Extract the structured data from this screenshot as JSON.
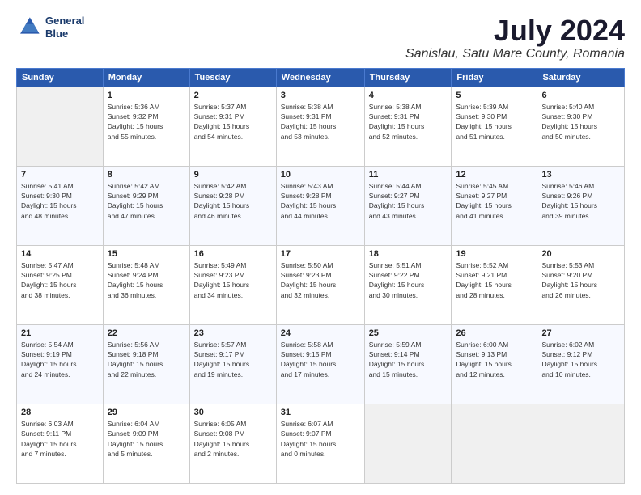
{
  "logo": {
    "line1": "General",
    "line2": "Blue"
  },
  "title": "July 2024",
  "subtitle": "Sanislau, Satu Mare County, Romania",
  "days_of_week": [
    "Sunday",
    "Monday",
    "Tuesday",
    "Wednesday",
    "Thursday",
    "Friday",
    "Saturday"
  ],
  "weeks": [
    [
      {
        "day": "",
        "info": ""
      },
      {
        "day": "1",
        "info": "Sunrise: 5:36 AM\nSunset: 9:32 PM\nDaylight: 15 hours\nand 55 minutes."
      },
      {
        "day": "2",
        "info": "Sunrise: 5:37 AM\nSunset: 9:31 PM\nDaylight: 15 hours\nand 54 minutes."
      },
      {
        "day": "3",
        "info": "Sunrise: 5:38 AM\nSunset: 9:31 PM\nDaylight: 15 hours\nand 53 minutes."
      },
      {
        "day": "4",
        "info": "Sunrise: 5:38 AM\nSunset: 9:31 PM\nDaylight: 15 hours\nand 52 minutes."
      },
      {
        "day": "5",
        "info": "Sunrise: 5:39 AM\nSunset: 9:30 PM\nDaylight: 15 hours\nand 51 minutes."
      },
      {
        "day": "6",
        "info": "Sunrise: 5:40 AM\nSunset: 9:30 PM\nDaylight: 15 hours\nand 50 minutes."
      }
    ],
    [
      {
        "day": "7",
        "info": "Sunrise: 5:41 AM\nSunset: 9:30 PM\nDaylight: 15 hours\nand 48 minutes."
      },
      {
        "day": "8",
        "info": "Sunrise: 5:42 AM\nSunset: 9:29 PM\nDaylight: 15 hours\nand 47 minutes."
      },
      {
        "day": "9",
        "info": "Sunrise: 5:42 AM\nSunset: 9:28 PM\nDaylight: 15 hours\nand 46 minutes."
      },
      {
        "day": "10",
        "info": "Sunrise: 5:43 AM\nSunset: 9:28 PM\nDaylight: 15 hours\nand 44 minutes."
      },
      {
        "day": "11",
        "info": "Sunrise: 5:44 AM\nSunset: 9:27 PM\nDaylight: 15 hours\nand 43 minutes."
      },
      {
        "day": "12",
        "info": "Sunrise: 5:45 AM\nSunset: 9:27 PM\nDaylight: 15 hours\nand 41 minutes."
      },
      {
        "day": "13",
        "info": "Sunrise: 5:46 AM\nSunset: 9:26 PM\nDaylight: 15 hours\nand 39 minutes."
      }
    ],
    [
      {
        "day": "14",
        "info": "Sunrise: 5:47 AM\nSunset: 9:25 PM\nDaylight: 15 hours\nand 38 minutes."
      },
      {
        "day": "15",
        "info": "Sunrise: 5:48 AM\nSunset: 9:24 PM\nDaylight: 15 hours\nand 36 minutes."
      },
      {
        "day": "16",
        "info": "Sunrise: 5:49 AM\nSunset: 9:23 PM\nDaylight: 15 hours\nand 34 minutes."
      },
      {
        "day": "17",
        "info": "Sunrise: 5:50 AM\nSunset: 9:23 PM\nDaylight: 15 hours\nand 32 minutes."
      },
      {
        "day": "18",
        "info": "Sunrise: 5:51 AM\nSunset: 9:22 PM\nDaylight: 15 hours\nand 30 minutes."
      },
      {
        "day": "19",
        "info": "Sunrise: 5:52 AM\nSunset: 9:21 PM\nDaylight: 15 hours\nand 28 minutes."
      },
      {
        "day": "20",
        "info": "Sunrise: 5:53 AM\nSunset: 9:20 PM\nDaylight: 15 hours\nand 26 minutes."
      }
    ],
    [
      {
        "day": "21",
        "info": "Sunrise: 5:54 AM\nSunset: 9:19 PM\nDaylight: 15 hours\nand 24 minutes."
      },
      {
        "day": "22",
        "info": "Sunrise: 5:56 AM\nSunset: 9:18 PM\nDaylight: 15 hours\nand 22 minutes."
      },
      {
        "day": "23",
        "info": "Sunrise: 5:57 AM\nSunset: 9:17 PM\nDaylight: 15 hours\nand 19 minutes."
      },
      {
        "day": "24",
        "info": "Sunrise: 5:58 AM\nSunset: 9:15 PM\nDaylight: 15 hours\nand 17 minutes."
      },
      {
        "day": "25",
        "info": "Sunrise: 5:59 AM\nSunset: 9:14 PM\nDaylight: 15 hours\nand 15 minutes."
      },
      {
        "day": "26",
        "info": "Sunrise: 6:00 AM\nSunset: 9:13 PM\nDaylight: 15 hours\nand 12 minutes."
      },
      {
        "day": "27",
        "info": "Sunrise: 6:02 AM\nSunset: 9:12 PM\nDaylight: 15 hours\nand 10 minutes."
      }
    ],
    [
      {
        "day": "28",
        "info": "Sunrise: 6:03 AM\nSunset: 9:11 PM\nDaylight: 15 hours\nand 7 minutes."
      },
      {
        "day": "29",
        "info": "Sunrise: 6:04 AM\nSunset: 9:09 PM\nDaylight: 15 hours\nand 5 minutes."
      },
      {
        "day": "30",
        "info": "Sunrise: 6:05 AM\nSunset: 9:08 PM\nDaylight: 15 hours\nand 2 minutes."
      },
      {
        "day": "31",
        "info": "Sunrise: 6:07 AM\nSunset: 9:07 PM\nDaylight: 15 hours\nand 0 minutes."
      },
      {
        "day": "",
        "info": ""
      },
      {
        "day": "",
        "info": ""
      },
      {
        "day": "",
        "info": ""
      }
    ]
  ]
}
